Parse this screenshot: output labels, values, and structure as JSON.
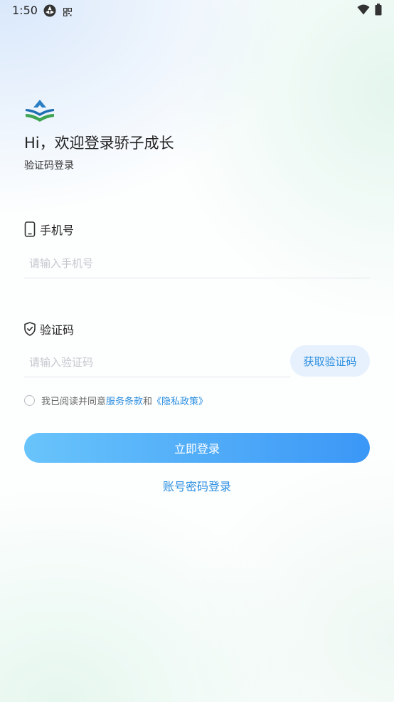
{
  "status_bar": {
    "time": "1:50",
    "icons": [
      "vpn-icon",
      "qr-icon",
      "wifi-icon",
      "battery-icon"
    ]
  },
  "app": {
    "logo_icon": "brand-logo",
    "greeting": "Hi，欢迎登录骄子成长",
    "subtitle": "验证码登录"
  },
  "form": {
    "phone": {
      "label": "手机号",
      "icon": "phone-icon",
      "placeholder": "请输入手机号",
      "value": ""
    },
    "code": {
      "label": "验证码",
      "icon": "shield-check-icon",
      "placeholder": "请输入验证码",
      "value": "",
      "get_code_label": "获取验证码"
    }
  },
  "agreement": {
    "prefix": "我已阅读并同意",
    "terms": "服务条款",
    "and": "和",
    "privacy": "《隐私政策》",
    "checked": false
  },
  "actions": {
    "login_label": "立即登录",
    "password_login_label": "账号密码登录"
  },
  "colors": {
    "accent": "#2a8ee0",
    "button_start": "#69c4fb",
    "button_end": "#3b97f6",
    "code_button_bg": "#e6f1fd"
  }
}
